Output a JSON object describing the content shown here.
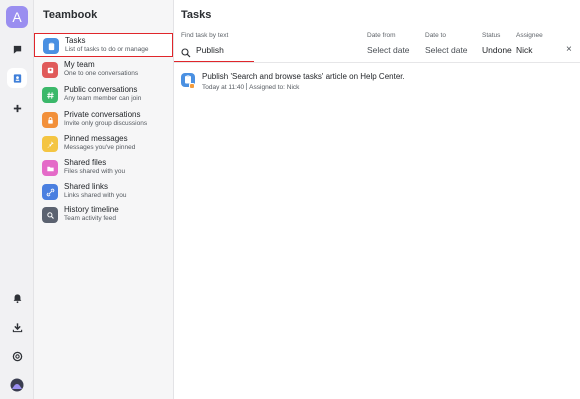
{
  "workspace": {
    "avatar_letter": "A",
    "avatar_color": "#9a8ef0"
  },
  "rail": {
    "items": [
      {
        "icon": "chat-icon"
      },
      {
        "icon": "teambook-icon",
        "active": true
      },
      {
        "icon": "plus-icon"
      },
      {
        "icon": "bell-icon"
      },
      {
        "icon": "download-icon"
      },
      {
        "icon": "help-icon"
      },
      {
        "icon": "user-avatar-icon"
      }
    ]
  },
  "sidebar": {
    "title": "Teambook",
    "items": [
      {
        "label": "Tasks",
        "sub": "List of tasks to do or manage",
        "color": "#4a90e2",
        "icon": "clipboard-icon",
        "selected": true
      },
      {
        "label": "My team",
        "sub": "One to one conversations",
        "color": "#e05a5a",
        "icon": "team-icon"
      },
      {
        "label": "Public conversations",
        "sub": "Any team member can join",
        "color": "#3bb86a",
        "icon": "hash-icon"
      },
      {
        "label": "Private conversations",
        "sub": "Invite only group discussions",
        "color": "#f2903a",
        "icon": "lock-icon"
      },
      {
        "label": "Pinned messages",
        "sub": "Messages you've pinned",
        "color": "#f4c542",
        "icon": "pin-icon"
      },
      {
        "label": "Shared files",
        "sub": "Files shared with you",
        "color": "#e46ac8",
        "icon": "folder-icon"
      },
      {
        "label": "Shared links",
        "sub": "Links shared with you",
        "color": "#4a7fe0",
        "icon": "link-icon"
      },
      {
        "label": "History timeline",
        "sub": "Team activity feed",
        "color": "#5b6270",
        "icon": "search-history-icon"
      }
    ]
  },
  "main": {
    "title": "Tasks",
    "filters": {
      "search_label": "Find task by text",
      "search_value": "Publish",
      "date_from_label": "Date from",
      "date_from_value": "Select date",
      "date_to_label": "Date to",
      "date_to_value": "Select date",
      "status_label": "Status",
      "status_value": "Undone",
      "assignee_label": "Assignee",
      "assignee_value": "Nick",
      "clear": "×"
    },
    "tasks": [
      {
        "title": "Publish 'Search and browse tasks' article on Help Center.",
        "time": "Today at 11:40",
        "assigned": "Assigned to: Nick"
      }
    ]
  },
  "colors": {
    "accent": "#e0262b",
    "link_blue": "#4a90e2"
  }
}
